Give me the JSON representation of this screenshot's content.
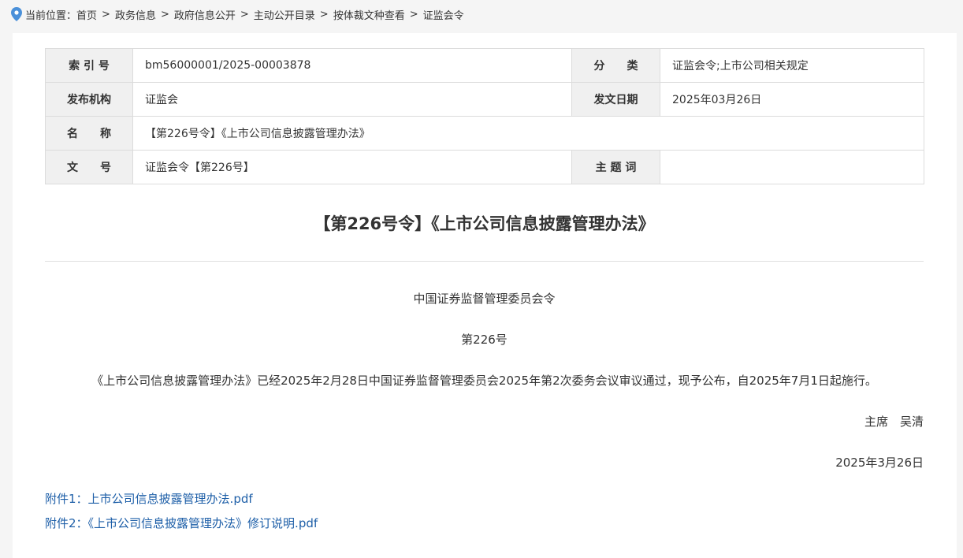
{
  "breadcrumb": {
    "prefix": "当前位置：",
    "items": [
      "首页",
      "政务信息",
      "政府信息公开",
      "主动公开目录",
      "按体裁文种查看",
      "证监会令"
    ],
    "separator": ">"
  },
  "meta": {
    "index_no_label": "索 引 号",
    "index_no_value": "bm56000001/2025-00003878",
    "category_label": "分　　类",
    "category_value": "证监会令;上市公司相关规定",
    "publisher_label": "发布机构",
    "publisher_value": "证监会",
    "date_label": "发文日期",
    "date_value": "2025年03月26日",
    "name_label": "名　　称",
    "name_value": "【第226号令】《上市公司信息披露管理办法》",
    "doc_no_label": "文　　号",
    "doc_no_value": "证监会令【第226号】",
    "keywords_label": "主 题 词",
    "keywords_value": ""
  },
  "document": {
    "title": "【第226号令】《上市公司信息披露管理办法》",
    "issuer": "中国证券监督管理委员会令",
    "number": "第226号",
    "content": "《上市公司信息披露管理办法》已经2025年2月28日中国证券监督管理委员会2025年第2次委务会议审议通过，现予公布，自2025年7月1日起施行。",
    "signature": "主席　吴清",
    "date": "2025年3月26日"
  },
  "attachments": [
    "附件1：上市公司信息披露管理办法.pdf",
    "附件2：《上市公司信息披露管理办法》修订说明.pdf"
  ],
  "colors": {
    "link": "#1e5fa8",
    "pin": "#4a90d9"
  }
}
